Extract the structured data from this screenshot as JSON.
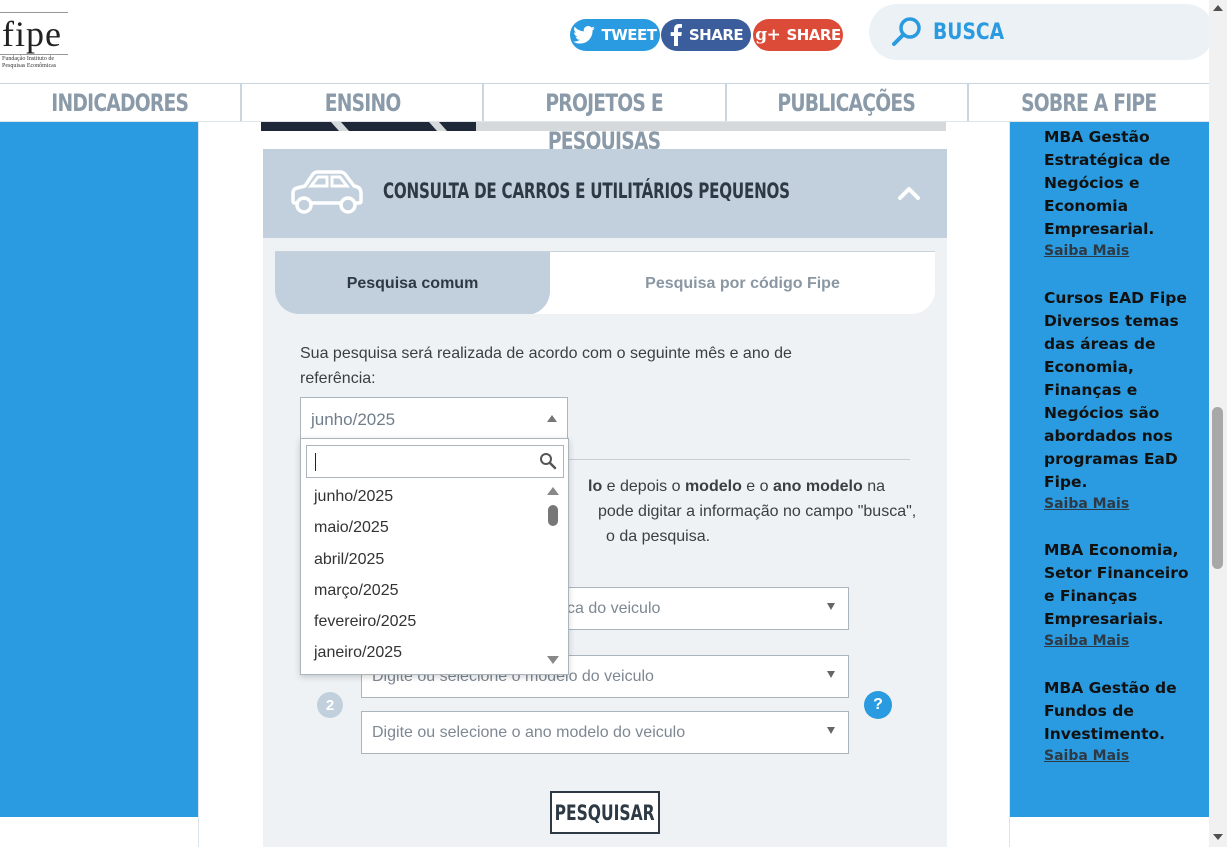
{
  "header": {
    "logo_text": "fipe",
    "logo_subtitle": "Fundação Instituto de Pesquisas Econômicas",
    "share": {
      "tweet": "TWEET",
      "facebook": "SHARE",
      "gplus": "SHARE",
      "gplus_prefix": "g+"
    },
    "search_label": "BUSCA"
  },
  "nav": [
    "INDICADORES",
    "ENSINO",
    "PROJETOS E PESQUISAS",
    "PUBLICAÇÕES",
    "SOBRE A FIPE"
  ],
  "panel": {
    "title": "CONSULTA DE CARROS E UTILITÁRIOS PEQUENOS",
    "tabs": {
      "common": "Pesquisa comum",
      "code": "Pesquisa por código Fipe"
    },
    "intro": "Sua pesquisa será realizada de acordo com o seguinte mês e ano de referência:",
    "reference_selected": "junho/2025",
    "instructions": {
      "line1_b1": "lo",
      "line1_t1": " e depois o ",
      "line1_b2": "modelo",
      "line1_t2": " e o ",
      "line1_b3": "ano modelo",
      "line1_t3": " na",
      "line2": "pode digitar a informação no campo \"busca\",",
      "line3": "o da pesquisa."
    },
    "fields": {
      "brand_placeholder": "ca do veiculo",
      "model_placeholder": "Digite ou selecione o modelo do veiculo",
      "year_placeholder": "Digite ou selecione o ano modelo do veiculo"
    },
    "step_number": "2",
    "help": "?",
    "search_button": "PESQUISAR"
  },
  "dropdown": {
    "search_value": "",
    "options": [
      "junho/2025",
      "maio/2025",
      "abril/2025",
      "março/2025",
      "fevereiro/2025",
      "janeiro/2025"
    ]
  },
  "sidebar": {
    "courses": [
      {
        "title": "MBA Gestão Estratégica de Negócios e Economia Empresarial.",
        "link": "Saiba Mais"
      },
      {
        "title": "Cursos EAD Fipe Diversos temas das áreas de Economia, Finanças e Negócios são abordados nos programas EaD Fipe.",
        "link": "Saiba Mais"
      },
      {
        "title": "MBA Economia, Setor Financeiro e Finanças Empresariais.",
        "link": "Saiba Mais"
      },
      {
        "title": "MBA Gestão de Fundos de Investimento.",
        "link": "Saiba Mais"
      }
    ]
  },
  "colors": {
    "accent": "#2a9be0",
    "panel_header": "#c1d0dc",
    "panel_bg": "#eef2f5",
    "twitter": "#2a9be0",
    "facebook": "#3b5d9c",
    "gplus": "#dc4a38"
  }
}
